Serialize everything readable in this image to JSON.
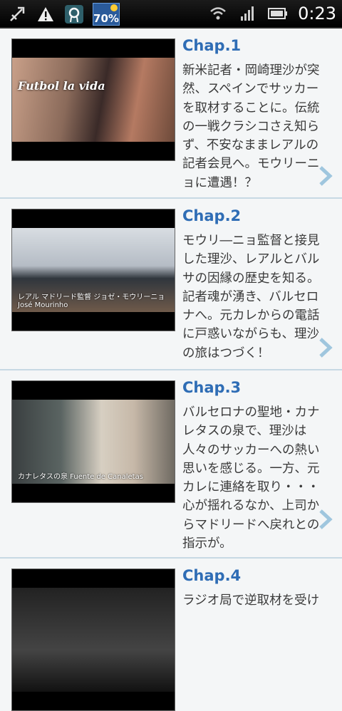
{
  "status_bar": {
    "time": "0:23",
    "battery_percent": "70%",
    "icons": [
      "usb-debug-icon",
      "warning-icon",
      "app-notification-icon",
      "weather-battery-icon",
      "wifi-icon",
      "signal-icon",
      "battery-icon"
    ]
  },
  "chapters": [
    {
      "title": "Chap.1",
      "description": "新米記者・岡崎理沙が突然、スペインでサッカーを取材することに。伝統の一戦クラシコさえ知らず、不安なままレアルの記者会見へ。モウリーニョに遭遇！？",
      "thumb_logo": "Futbol la vida",
      "thumb_caption": ""
    },
    {
      "title": "Chap.2",
      "description": "モウリ―ニョ監督と接見した理沙、レアルとバルサの因縁の歴史を知る。記者魂が湧き、バルセロナへ。元カレからの電話に戸惑いながらも、理沙の旅はつづく！",
      "thumb_logo": "",
      "thumb_caption": "レアル マドリード監督 ジョゼ・モウリーニョ José Mourinho"
    },
    {
      "title": "Chap.3",
      "description": "バルセロナの聖地・カナレタスの泉で、理沙は人々のサッカーへの熱い思いを感じる。一方、元カレに連絡を取り・・・心が揺れるなか、上司からマドリードへ戻れとの指示が。",
      "thumb_logo": "",
      "thumb_caption": "カナレタスの泉 Fuente de Canaletas"
    },
    {
      "title": "Chap.4",
      "description": "ラジオ局で逆取材を受け",
      "thumb_logo": "",
      "thumb_caption": ""
    }
  ],
  "colors": {
    "title": "#2f6db5",
    "divider": "#c7d9e4",
    "chevron": "#9fc6de",
    "background": "#f4f6f7"
  }
}
